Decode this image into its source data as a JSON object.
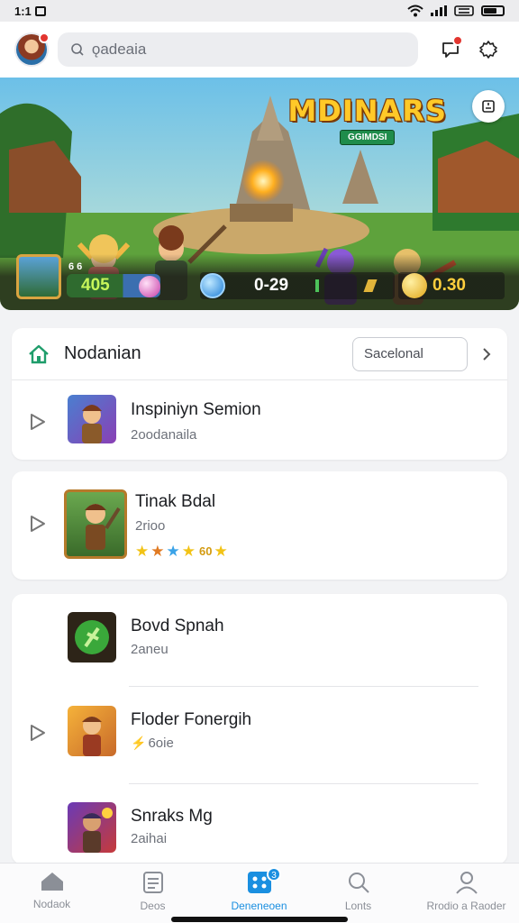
{
  "status_bar": {
    "time": "1:1",
    "carrier_box": ""
  },
  "header": {
    "search_placeholder": "ǫadeaia"
  },
  "banner": {
    "logo_line1": "MDINARS",
    "logo_line2": "GGIMDSI",
    "hud": {
      "level_small": "6 6",
      "score": "405",
      "timer": "0-29",
      "gold": "0.30"
    }
  },
  "section": {
    "title": "Nodanian",
    "select_value": "Sacelonal",
    "items": [
      {
        "title": "Inspiniyn Semion",
        "subtitle": "2oodanaila"
      }
    ]
  },
  "featured": {
    "title": "Tinak Bdal",
    "subtitle": "2rioo",
    "rating_value": "60"
  },
  "list": {
    "items": [
      {
        "title": "Bovd Spnah",
        "subtitle": "2aneu"
      },
      {
        "title": "Floder Fonergih",
        "subtitle": "6oie"
      },
      {
        "title": "Snraks Mg",
        "subtitle": "2aihai"
      }
    ]
  },
  "bottom_nav": {
    "items": [
      {
        "label": "Nodaok"
      },
      {
        "label": "Deos"
      },
      {
        "label": "Deneneoen",
        "badge": "3"
      },
      {
        "label": "Lonts"
      },
      {
        "label": "Rrodio a Raoder"
      }
    ],
    "active_index": 2
  },
  "colors": {
    "accent": "#1a8fe0",
    "home_green": "#1f9d6b",
    "notification_red": "#e2352f",
    "gold": "#ffc928"
  }
}
